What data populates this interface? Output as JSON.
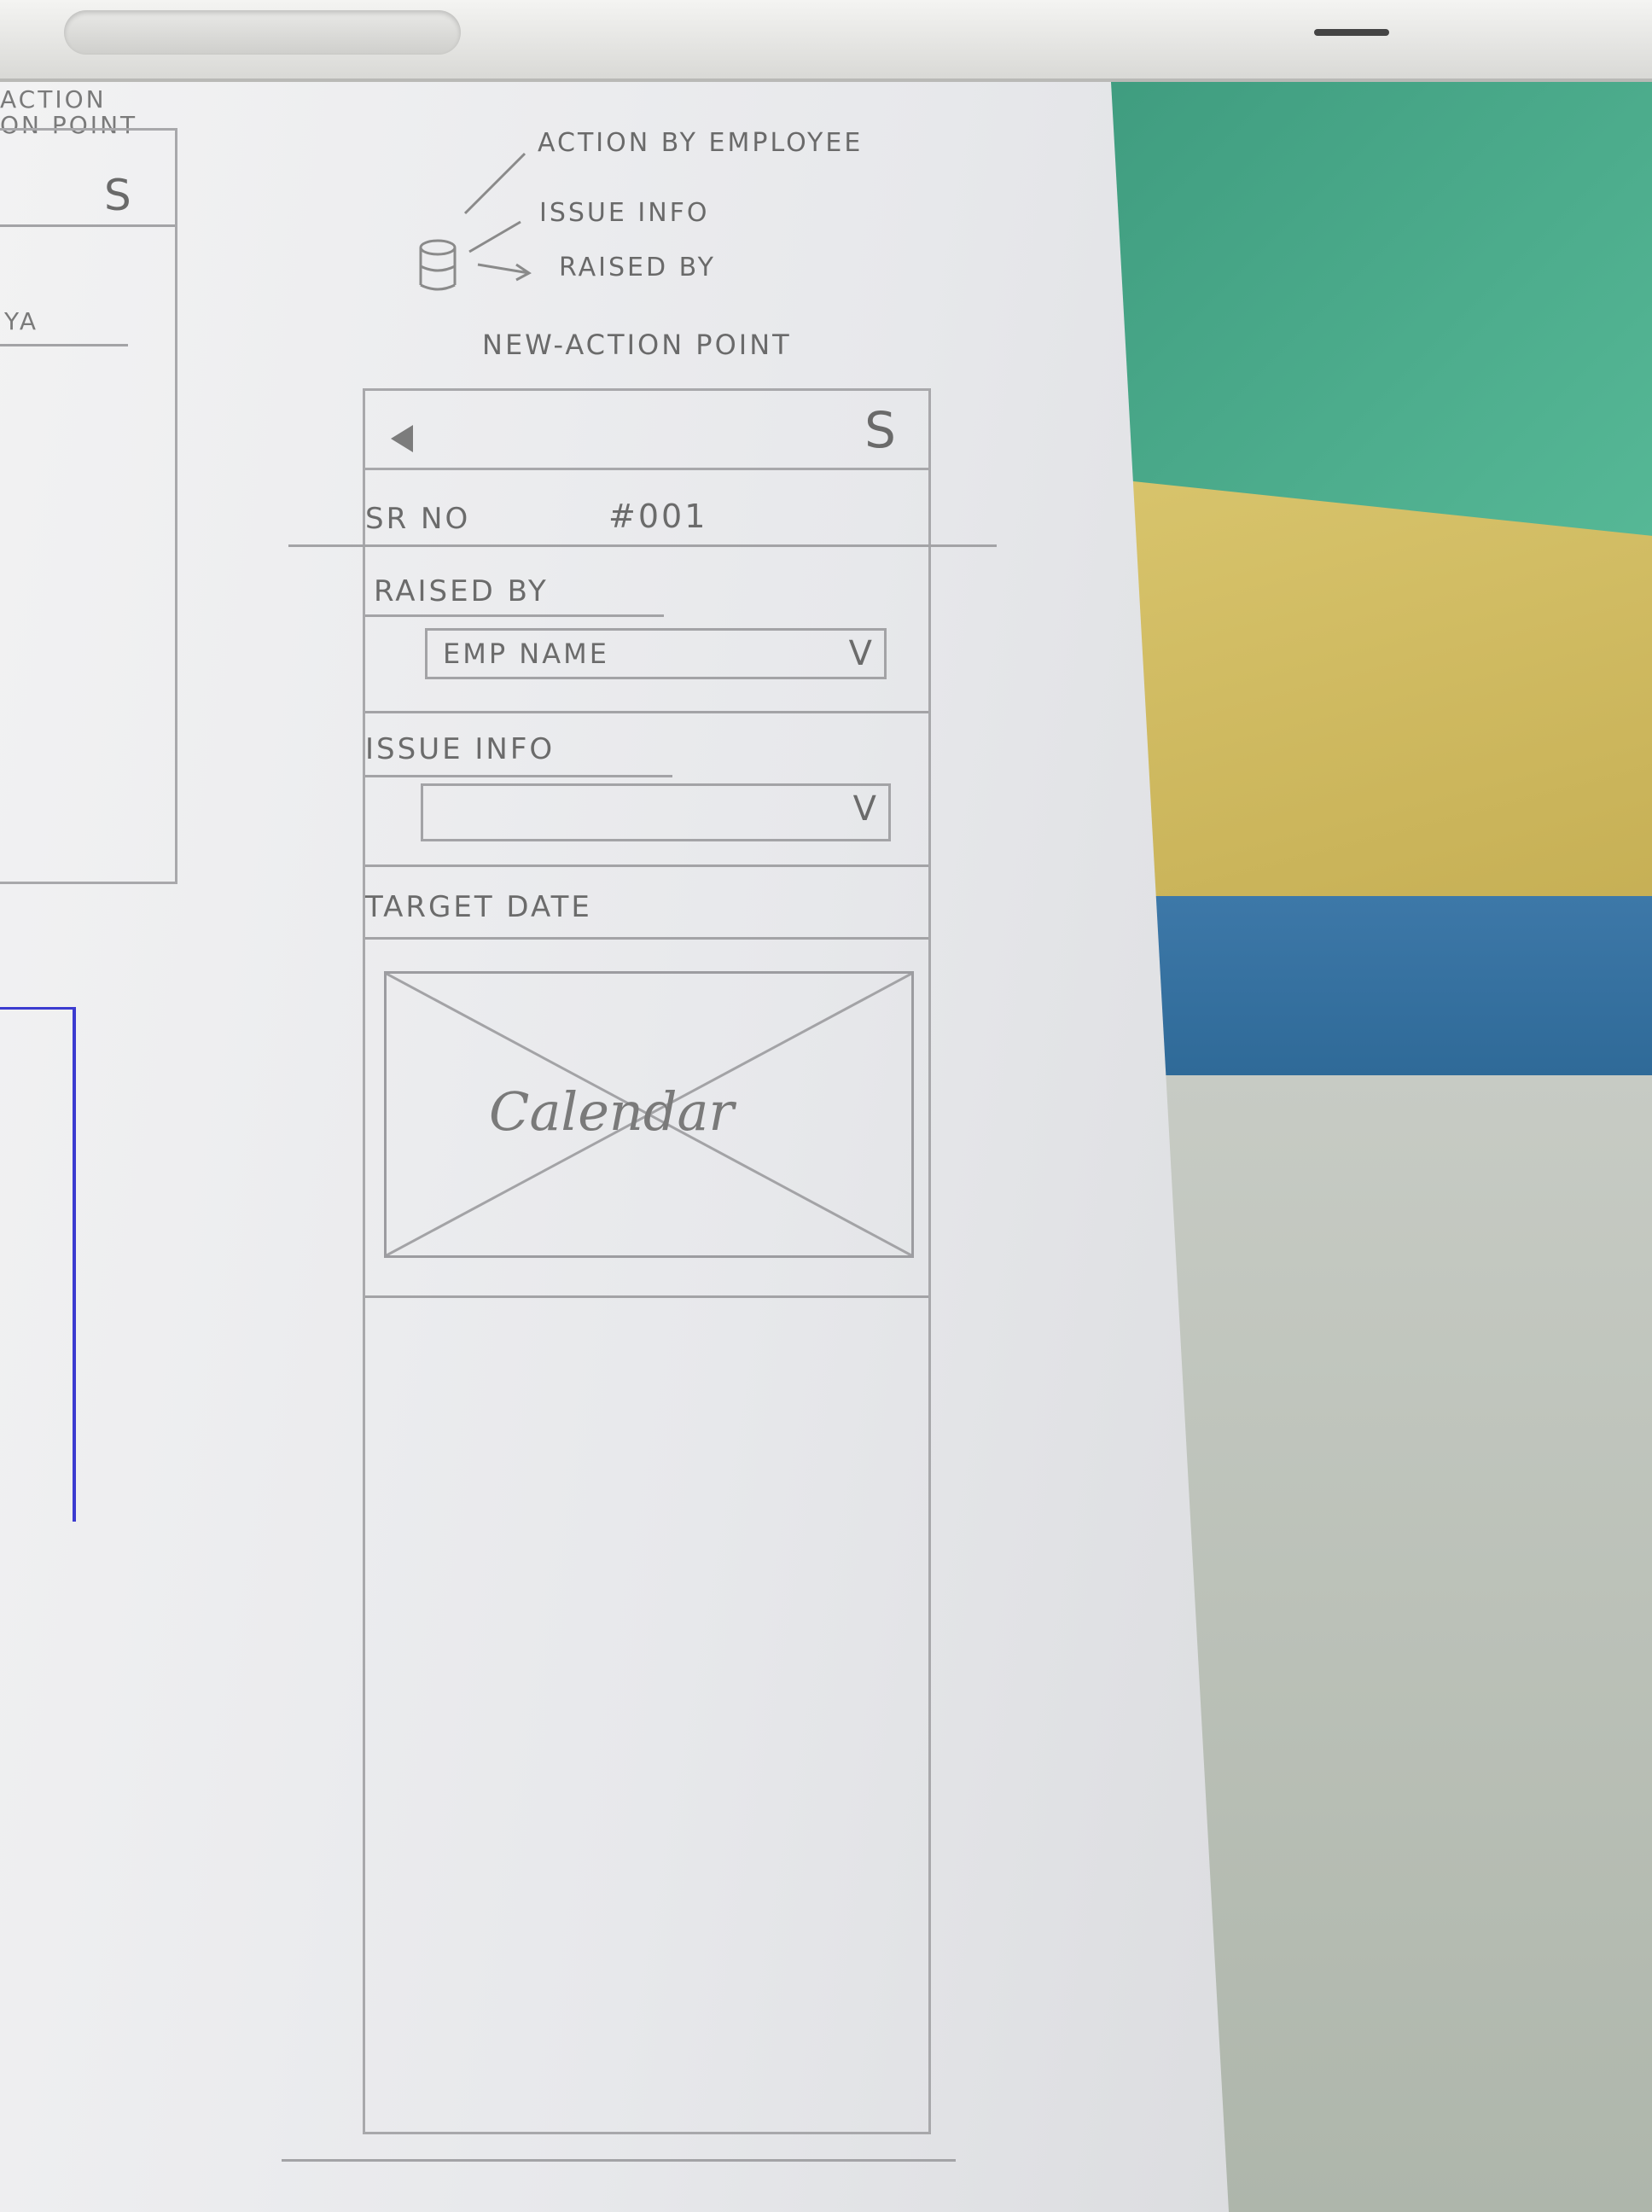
{
  "sketch": {
    "top_notes": {
      "action_by": "ACTION BY EMPLOYEE",
      "issue_info": "ISSUE INFO",
      "raised_by": "RAISED BY"
    },
    "screen_title": "NEW-ACTION POINT",
    "prev_screen": {
      "title_line1": "ACTION",
      "title_line2": "ON POINT",
      "header_icon": "S",
      "fragment": "YA"
    }
  },
  "app": {
    "header": {
      "back_icon": "back-arrow-icon",
      "menu_icon": "S"
    },
    "serial": {
      "label": "SR NO",
      "value": "#001"
    },
    "raised_by": {
      "label": "RAISED BY",
      "value": "EMP NAME",
      "chevron": "V"
    },
    "issue_info": {
      "label": "ISSUE INFO",
      "value": "",
      "chevron": "V"
    },
    "target_date": {
      "label": "TARGET DATE",
      "calendar_label": "Calendar"
    }
  }
}
